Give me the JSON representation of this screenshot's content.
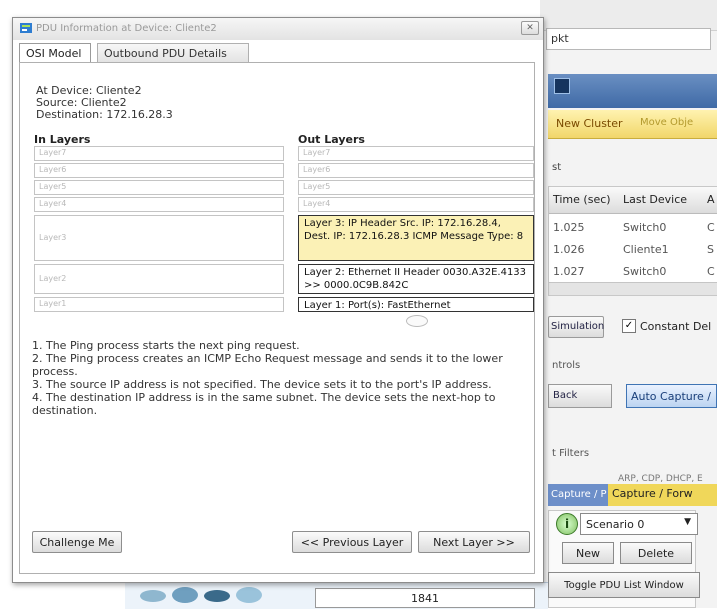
{
  "dialog": {
    "title": "PDU Information at Device: Cliente2",
    "tabs": [
      {
        "label": "OSI Model",
        "active": true
      },
      {
        "label": "Outbound PDU Details",
        "active": false
      }
    ],
    "device_line": "At Device: Cliente2",
    "source_line": "Source: Cliente2",
    "destination_line": "Destination: 172.16.28.3",
    "in_layers_label": "In Layers",
    "out_layers_label": "Out Layers",
    "in_layers": [
      "Layer7",
      "Layer6",
      "Layer5",
      "Layer4",
      "Layer3",
      "Layer2",
      "Layer1"
    ],
    "out_layers": [
      "Layer7",
      "Layer6",
      "Layer5",
      "Layer4",
      "Layer 3: IP Header Src. IP: 172.16.28.4, Dest. IP: 172.16.28.3 ICMP Message Type: 8",
      "Layer 2: Ethernet II Header 0030.A32E.4133 >> 0000.0C9B.842C",
      "Layer 1: Port(s): FastEthernet"
    ],
    "steps": [
      "1. The Ping process starts the next ping request.",
      "2. The Ping process creates an ICMP Echo Request message and sends it to the lower process.",
      "3. The source IP address is not specified. The device sets it to the port's IP address.",
      "4. The destination IP address is in the same subnet. The device sets the next-hop to destination."
    ],
    "buttons": {
      "challenge": "Challenge Me",
      "previous": "<< Previous Layer",
      "next": "Next Layer >>"
    }
  },
  "background": {
    "top_input": "pkt",
    "cluster_bar": {
      "new_cluster": "New Cluster",
      "move_object": "Move Obje"
    },
    "event_list_label": "st",
    "table": {
      "headers": [
        "Time (sec)",
        "Last Device",
        "A"
      ],
      "rows": [
        [
          "1.025",
          "Switch0",
          "C"
        ],
        [
          "1.026",
          "Cliente1",
          "S"
        ],
        [
          "1.027",
          "Switch0",
          "C"
        ]
      ]
    },
    "simulation_button": "Simulation",
    "constant_delay_label": "Constant Del",
    "constant_delay_checked": true,
    "controls_label": "ntrols",
    "back_button": "Back",
    "auto_capture_button": "Auto Capture /",
    "filters_label": "t Filters",
    "filters_protocols": "ARP, CDP, DHCP, E",
    "capture_tab": "Capture / P",
    "capture_forward": "Capture / Forw",
    "scenario": {
      "selected": "Scenario 0",
      "icon": "info-icon"
    },
    "new_button": "New",
    "delete_button": "Delete",
    "toggle_button": "Toggle PDU List Window",
    "bottom_field": "1841"
  },
  "colors": {
    "highlight": "#fbf1b6",
    "cluster_bar": "#f1d66a",
    "capture_bar": "#f0d75a",
    "capture_tab": "#6d8fc9",
    "auto_capture": "#bcd4f1"
  }
}
